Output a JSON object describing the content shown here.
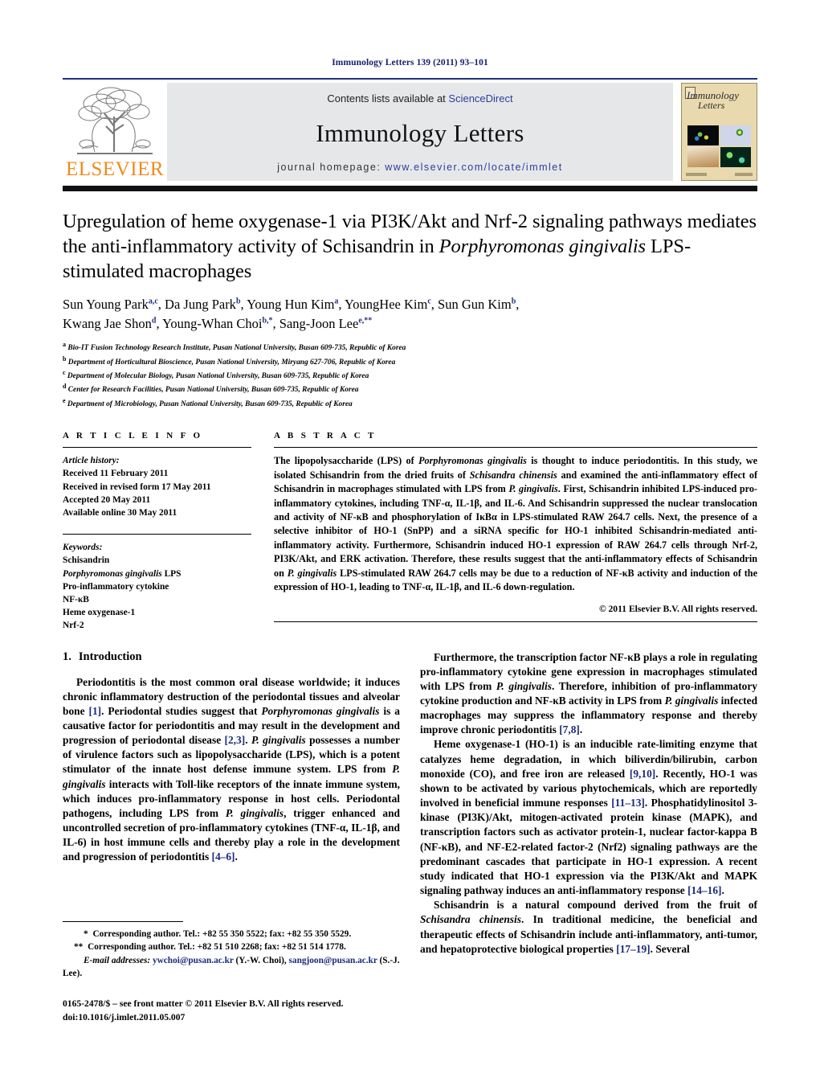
{
  "running_head": "Immunology Letters 139 (2011) 93–101",
  "masthead": {
    "publisher_name": "ELSEVIER",
    "contents_prefix": "Contents lists available at ",
    "contents_link": "ScienceDirect",
    "journal_title": "Immunology Letters",
    "homepage_prefix": "journal homepage: ",
    "homepage_url": "www.elsevier.com/locate/immlet",
    "cover_title_line1": "Immunology",
    "cover_title_line2": "Letters",
    "link_color": "#2b3f9e",
    "band_color": "#e6e7e9",
    "brand_orange": "#f08a1c",
    "rule_color": "#23307a"
  },
  "article": {
    "title_part1": "Upregulation of heme oxygenase-1 via PI3K/Akt and Nrf-2 signaling pathways mediates the anti-inflammatory activity of Schisandrin in ",
    "title_italic1": "Porphyromonas gingivalis",
    "title_part2": " LPS-stimulated macrophages",
    "authors_line1_a": "Sun Young Park",
    "authors_sup1": "a,c",
    "authors_line1_b": ", Da Jung Park",
    "authors_sup2": "b",
    "authors_line1_c": ", Young Hun Kim",
    "authors_sup3": "a",
    "authors_line1_d": ", YoungHee Kim",
    "authors_sup4": "c",
    "authors_line1_e": ", Sun Gun Kim",
    "authors_sup5": "b",
    "authors_line1_f": ",",
    "authors_line2_a": "Kwang Jae Shon",
    "authors_sup6": "d",
    "authors_line2_b": ", Young-Whan Choi",
    "authors_sup7": "b,*",
    "authors_line2_c": ", Sang-Joon Lee",
    "authors_sup8": "e,**",
    "affiliations": [
      {
        "mark": "a",
        "text": "Bio-IT Fusion Technology Research Institute, Pusan National University, Busan 609-735, Republic of Korea"
      },
      {
        "mark": "b",
        "text": "Department of Horticultural Bioscience, Pusan National University, Miryang 627-706, Republic of Korea"
      },
      {
        "mark": "c",
        "text": "Department of Molecular Biology, Pusan National University, Busan 609-735, Republic of Korea"
      },
      {
        "mark": "d",
        "text": "Center for Research Facilities, Pusan National University, Busan 609-735, Republic of Korea"
      },
      {
        "mark": "e",
        "text": "Department of Microbiology, Pusan National University, Busan 609-735, Republic of Korea"
      }
    ]
  },
  "article_info": {
    "heading": "A R T I C L E   I N F O",
    "history_label": "Article history:",
    "history": [
      "Received 11 February 2011",
      "Received in revised form 17 May 2011",
      "Accepted 20 May 2011",
      "Available online 30 May 2011"
    ],
    "keywords_label": "Keywords:",
    "keywords": [
      "Schisandrin",
      "Porphyromonas gingivalis LPS",
      "Pro-inflammatory cytokine",
      "NF-κB",
      "Heme oxygenase-1",
      "Nrf-2"
    ],
    "keyword_italic_index": 1,
    "keyword_italic_part": "Porphyromonas gingivalis",
    "keyword_italic_rest": " LPS"
  },
  "abstract": {
    "heading": "A B S T R A C T",
    "s1": "The lipopolysaccharide (LPS) of ",
    "i1": "Porphyromonas gingivalis",
    "s2": " is thought to induce periodontitis. In this study, we isolated Schisandrin from the dried fruits of ",
    "i2": "Schisandra chinensis",
    "s3": " and examined the anti-inflammatory effect of Schisandrin in macrophages stimulated with LPS from ",
    "i3": "P. gingivalis",
    "s4": ". First, Schisandrin inhibited LPS-induced pro-inflammatory cytokines, including TNF-α, IL-1β, and IL-6. And Schisandrin suppressed the nuclear translocation and activity of NF-κB and phosphorylation of IκBα in LPS-stimulated RAW 264.7 cells. Next, the presence of a selective inhibitor of HO-1 (SnPP) and a siRNA specific for HO-1 inhibited Schisandrin-mediated anti-inflammatory activity. Furthermore, Schisandrin induced HO-1 expression of RAW 264.7 cells through Nrf-2, PI3K/Akt, and ERK activation. Therefore, these results suggest that the anti-inflammatory effects of Schisandrin on ",
    "i4": "P. gingivalis",
    "s5": " LPS-stimulated RAW 264.7 cells may be due to a reduction of NF-κB activity and induction of the expression of HO-1, leading to TNF-α, IL-1β, and IL-6 down-regulation.",
    "copyright": "© 2011 Elsevier B.V. All rights reserved."
  },
  "introduction": {
    "section_number": "1.",
    "section_title": "Introduction",
    "left_p1_a": "Periodontitis is the most common oral disease worldwide; it induces chronic inflammatory destruction of the periodontal tissues and alveolar bone ",
    "left_p1_r1": "[1]",
    "left_p1_b": ". Periodontal studies suggest that ",
    "left_p1_i1": "Porphyromonas gingivalis",
    "left_p1_c": " is a causative factor for periodontitis and may result in the development and progression of periodontal disease ",
    "left_p1_r2": "[2,3]",
    "left_p1_d": ". ",
    "left_p1_i2": "P. gingivalis",
    "left_p1_e": " possesses a number of virulence factors such as lipopolysaccharide (LPS), which is a potent stimulator of the innate host defense immune system. LPS from ",
    "left_p1_i3": "P. gingivalis",
    "left_p1_f": " interacts with Toll-like receptors of the innate immune system, which induces pro-inflammatory response in host cells. Periodontal pathogens, including LPS from ",
    "left_p1_i4": "P. gingivalis",
    "left_p1_g": ", trigger enhanced and uncontrolled secretion of pro-inflammatory cytokines (TNF-α, IL-1β, and IL-6) in host immune cells and thereby play a role in the development and progression of periodontitis ",
    "left_p1_r3": "[4–6]",
    "left_p1_h": ".",
    "right_p1_a": "Furthermore, the transcription factor NF-κB plays a role in regulating pro-inflammatory cytokine gene expression in macrophages stimulated with LPS from ",
    "right_p1_i1": "P. gingivalis",
    "right_p1_b": ". Therefore, inhibition of pro-inflammatory cytokine production and NF-κB activity in LPS from ",
    "right_p1_i2": "P. gingivalis",
    "right_p1_c": " infected macrophages may suppress the inflammatory response and thereby improve chronic periodontitis ",
    "right_p1_r1": "[7,8]",
    "right_p1_d": ".",
    "right_p2_a": "Heme oxygenase-1 (HO-1) is an inducible rate-limiting enzyme that catalyzes heme degradation, in which biliverdin/bilirubin, carbon monoxide (CO), and free iron are released ",
    "right_p2_r1": "[9,10]",
    "right_p2_b": ". Recently, HO-1 was shown to be activated by various phytochemicals, which are reportedly involved in beneficial immune responses ",
    "right_p2_r2": "[11–13]",
    "right_p2_c": ". Phosphatidylinositol 3-kinase (PI3K)/Akt, mitogen-activated protein kinase (MAPK), and transcription factors such as activator protein-1, nuclear factor-kappa B (NF-κB), and NF-E2-related factor-2 (Nrf2) signaling pathways are the predominant cascades that participate in HO-1 expression. A recent study indicated that HO-1 expression via the PI3K/Akt and MAPK signaling pathway induces an anti-inflammatory response ",
    "right_p2_r3": "[14–16]",
    "right_p2_d": ".",
    "right_p3_a": "Schisandrin is a natural compound derived from the fruit of ",
    "right_p3_i1": "Schisandra chinensis",
    "right_p3_b": ". In traditional medicine, the beneficial and therapeutic effects of Schisandrin include anti-inflammatory, anti-tumor, and hepatoprotective biological properties ",
    "right_p3_r1": "[17–19]",
    "right_p3_c": ". Several"
  },
  "footnotes": {
    "fn1_star": "*",
    "fn1_text": " Corresponding author. Tel.: +82 55 350 5522; fax: +82 55 350 5529.",
    "fn2_star": "**",
    "fn2_text": " Corresponding author. Tel.: +82 51 510 2268; fax: +82 51 514 1778.",
    "email_label": "E-mail addresses:",
    "email1": "ywchoi@pusan.ac.kr",
    "email1_owner": " (Y.-W. Choi), ",
    "email2": "sangjoon@pusan.ac.kr",
    "email2_owner": " (S.-J. Lee).",
    "imprint_line1": "0165-2478/$ – see front matter © 2011 Elsevier B.V. All rights reserved.",
    "imprint_line2": "doi:10.1016/j.imlet.2011.05.007"
  }
}
